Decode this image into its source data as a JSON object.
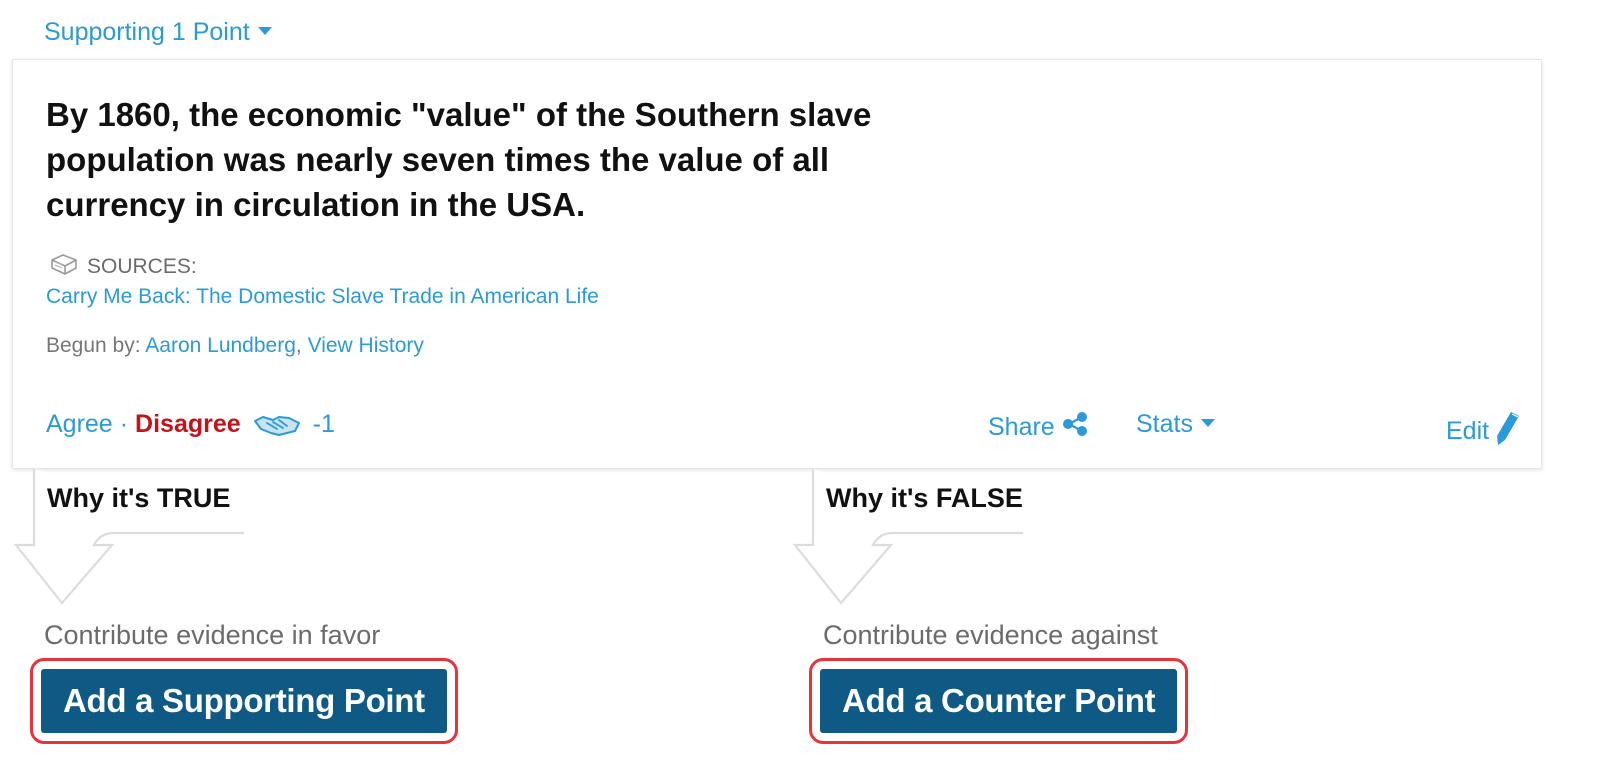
{
  "header": {
    "supporting_label": "Supporting 1 Point"
  },
  "claim": {
    "text": "By 1860, the economic \"value\" of the Southern slave population was nearly seven times the value of all currency in circulation in the USA."
  },
  "sources": {
    "label": "SOURCES:",
    "icon": "book-icon",
    "items": [
      {
        "title": "Carry Me Back: The Domestic Slave Trade in American Life"
      }
    ]
  },
  "begun": {
    "prefix": "Begun by:",
    "author": "Aaron Lundberg",
    "separator": ",",
    "history_link": "View History"
  },
  "actions": {
    "agree": "Agree",
    "dot": "·",
    "disagree": "Disagree",
    "score": "-1",
    "share": "Share",
    "stats": "Stats",
    "edit": "Edit"
  },
  "columns": {
    "true": {
      "title": "Why it's TRUE",
      "contribute": "Contribute evidence in favor",
      "button": "Add a Supporting Point"
    },
    "false": {
      "title": "Why it's FALSE",
      "contribute": "Contribute evidence against",
      "button": "Add a Counter Point"
    }
  },
  "colors": {
    "link": "#2b9ad8",
    "disagree": "#c4111a",
    "button_bg": "#0e5a84",
    "highlight_border": "#e8333a"
  }
}
